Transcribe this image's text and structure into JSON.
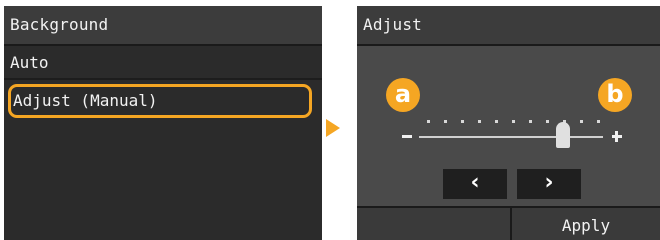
{
  "left_screen": {
    "title": "Background",
    "items": [
      {
        "label": "Auto"
      },
      {
        "label": "Adjust (Manual)",
        "selected": true
      }
    ]
  },
  "right_screen": {
    "title": "Adjust",
    "badge_a": "a",
    "badge_b": "b",
    "slider_level": 0.8,
    "left_button": "‹",
    "right_button": "›",
    "apply_label": "Apply"
  },
  "colors": {
    "accent": "#f5a623",
    "screen_bg": "#2b2b2b",
    "panel_bg": "#4a4a4a"
  }
}
